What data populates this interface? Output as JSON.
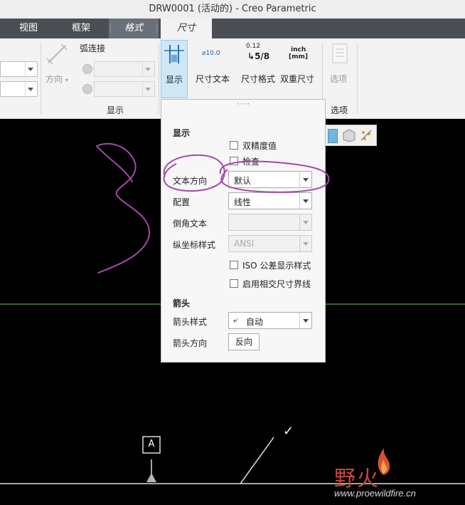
{
  "window": {
    "title": "DRW0001 (活动的) - Creo Parametric"
  },
  "tabs": [
    {
      "label": "视图"
    },
    {
      "label": "框架"
    },
    {
      "label": "格式"
    },
    {
      "label": "尺寸"
    }
  ],
  "ribbon": {
    "direction_label": "方向",
    "arc_connect_label": "弧连接",
    "display_group_label": "显示",
    "display_button_label": "显示",
    "dim_text_label": "尺寸文本",
    "dim_text_icon_text": "⌀10.0",
    "dim_format_label": "尺寸格式",
    "dim_format_top": "0.12",
    "dim_format_frac": "5/8",
    "dual_dim_label": "双重尺寸",
    "dual_dim_icon_top": "inch",
    "dual_dim_icon_bottom": "[mm]",
    "options_button_label": "选项",
    "options_group_label": "选项",
    "colors": {
      "ribbon_bg": "#f3f3f3",
      "active_button": "#cfe6f7"
    }
  },
  "panel": {
    "handle": "····",
    "display_header": "显示",
    "double_precision_label": "双精度值",
    "double_precision_checked": false,
    "inspection_label": "检查",
    "inspection_checked": false,
    "text_orientation_label": "文本方向",
    "text_orientation_value": "默认",
    "placement_label": "配置",
    "placement_value": "线性",
    "chamfer_text_label": "倒角文本",
    "chamfer_text_value": "",
    "ordinate_style_label": "纵坐标样式",
    "ordinate_style_value": "ANSI",
    "iso_tolerance_label": "ISO 公差显示样式",
    "iso_tolerance_checked": false,
    "intersect_ext_label": "启用相交尺寸界线",
    "intersect_ext_checked": false,
    "arrows_header": "箭头",
    "arrow_style_label": "箭头样式",
    "arrow_style_value": "自动",
    "arrow_direction_label": "箭头方向",
    "flip_button_label": "反向"
  },
  "canvas": {
    "datum_label": "A",
    "check_mark": "✓",
    "annotation_color": "#a24aa8"
  },
  "watermark": {
    "brand": "野火",
    "url": "www.proewildfire.cn"
  }
}
